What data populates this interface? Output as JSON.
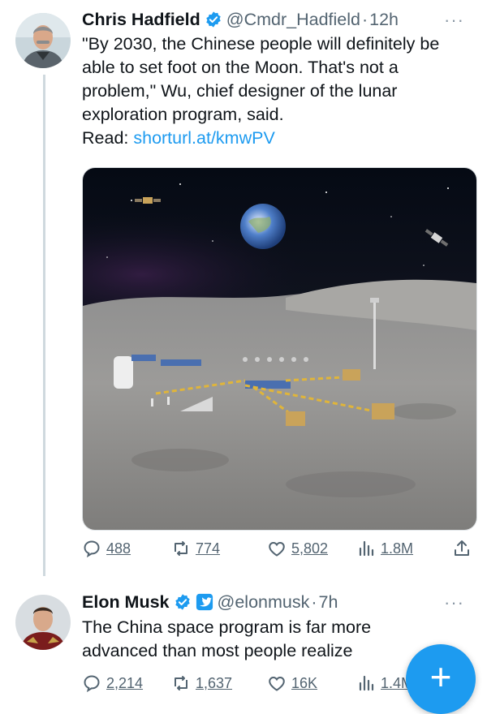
{
  "tweet1": {
    "name": "Chris Hadfield",
    "handle": "@Cmdr_Hadfield",
    "separator": "·",
    "time": "12h",
    "more": "···",
    "text_lines": [
      "\"By 2030, the Chinese people will definitely be",
      "able to set foot on the Moon. That's not a",
      "problem,\" Wu, chief designer of the lunar",
      "exploration program, said."
    ],
    "read_label": "Read:",
    "link": "shorturl.at/kmwPV",
    "stats": {
      "replies": "488",
      "retweets": "774",
      "likes": "5,802",
      "views": "1.8M"
    }
  },
  "tweet2": {
    "name": "Elon Musk",
    "handle": "@elonmusk",
    "separator": "·",
    "time": "7h",
    "more": "···",
    "text_lines": [
      "The China space program is far more",
      "advanced than most people realize"
    ],
    "stats": {
      "replies": "2,214",
      "retweets": "1,637",
      "likes": "16K",
      "views": "1.4M"
    }
  },
  "fab": {
    "label": "+"
  },
  "colors": {
    "accent": "#1d9bf0",
    "text": "#0f1419",
    "secondary": "#536471",
    "thread_line": "#cfd9de",
    "gov_badge": "#829aab"
  },
  "icons": {
    "reply": "reply-icon",
    "retweet": "retweet-icon",
    "like": "heart-icon",
    "views": "views-icon",
    "share": "share-icon",
    "verified": "verified-badge-icon",
    "affiliate": "affiliate-x-badge-icon",
    "compose": "compose-plus-icon"
  }
}
